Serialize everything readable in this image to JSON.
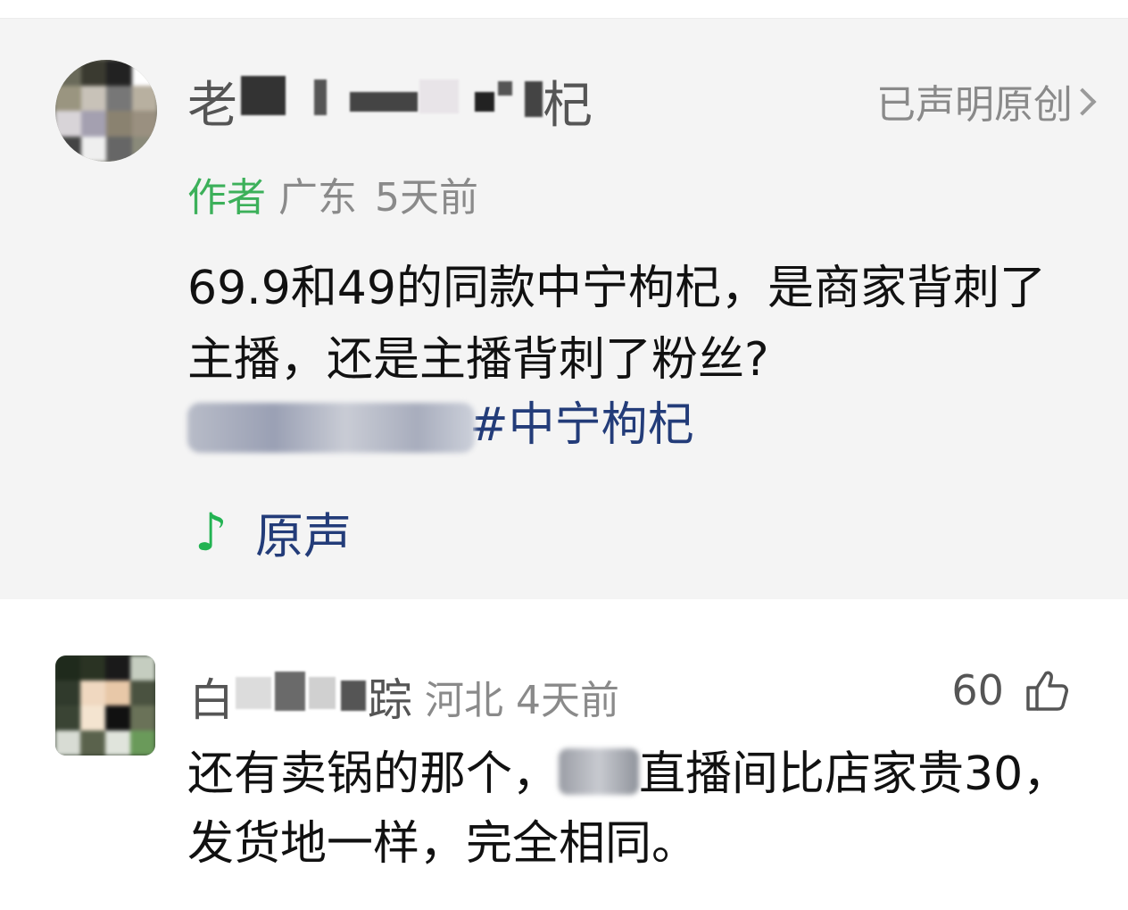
{
  "post": {
    "author_name_prefix": "老",
    "author_name_suffix": "杞",
    "declared_label": "已声明原创",
    "role_label": "作者",
    "location": "广东",
    "time": "5天前",
    "text": "69.9和49的同款中宁枸杞，是商家背刺了主播，还是主播背刺了粉丝?",
    "hashtag_tail": "#中宁枸杞",
    "sound_label": "原声"
  },
  "comment": {
    "author_name_prefix": "白",
    "author_name_suffix": "踪",
    "location": "河北",
    "time": "4天前",
    "like_count": "60",
    "text_before": "还有卖锅的那个，",
    "text_after": "直播间比店家贵30，发货地一样，完全相同。"
  },
  "colors": {
    "accent_green": "#3cb05a",
    "link_blue": "#233c79",
    "gray_text": "#8a8a8a"
  },
  "icons": [
    "chevron-right-icon",
    "music-note-icon",
    "thumbs-up-icon"
  ]
}
